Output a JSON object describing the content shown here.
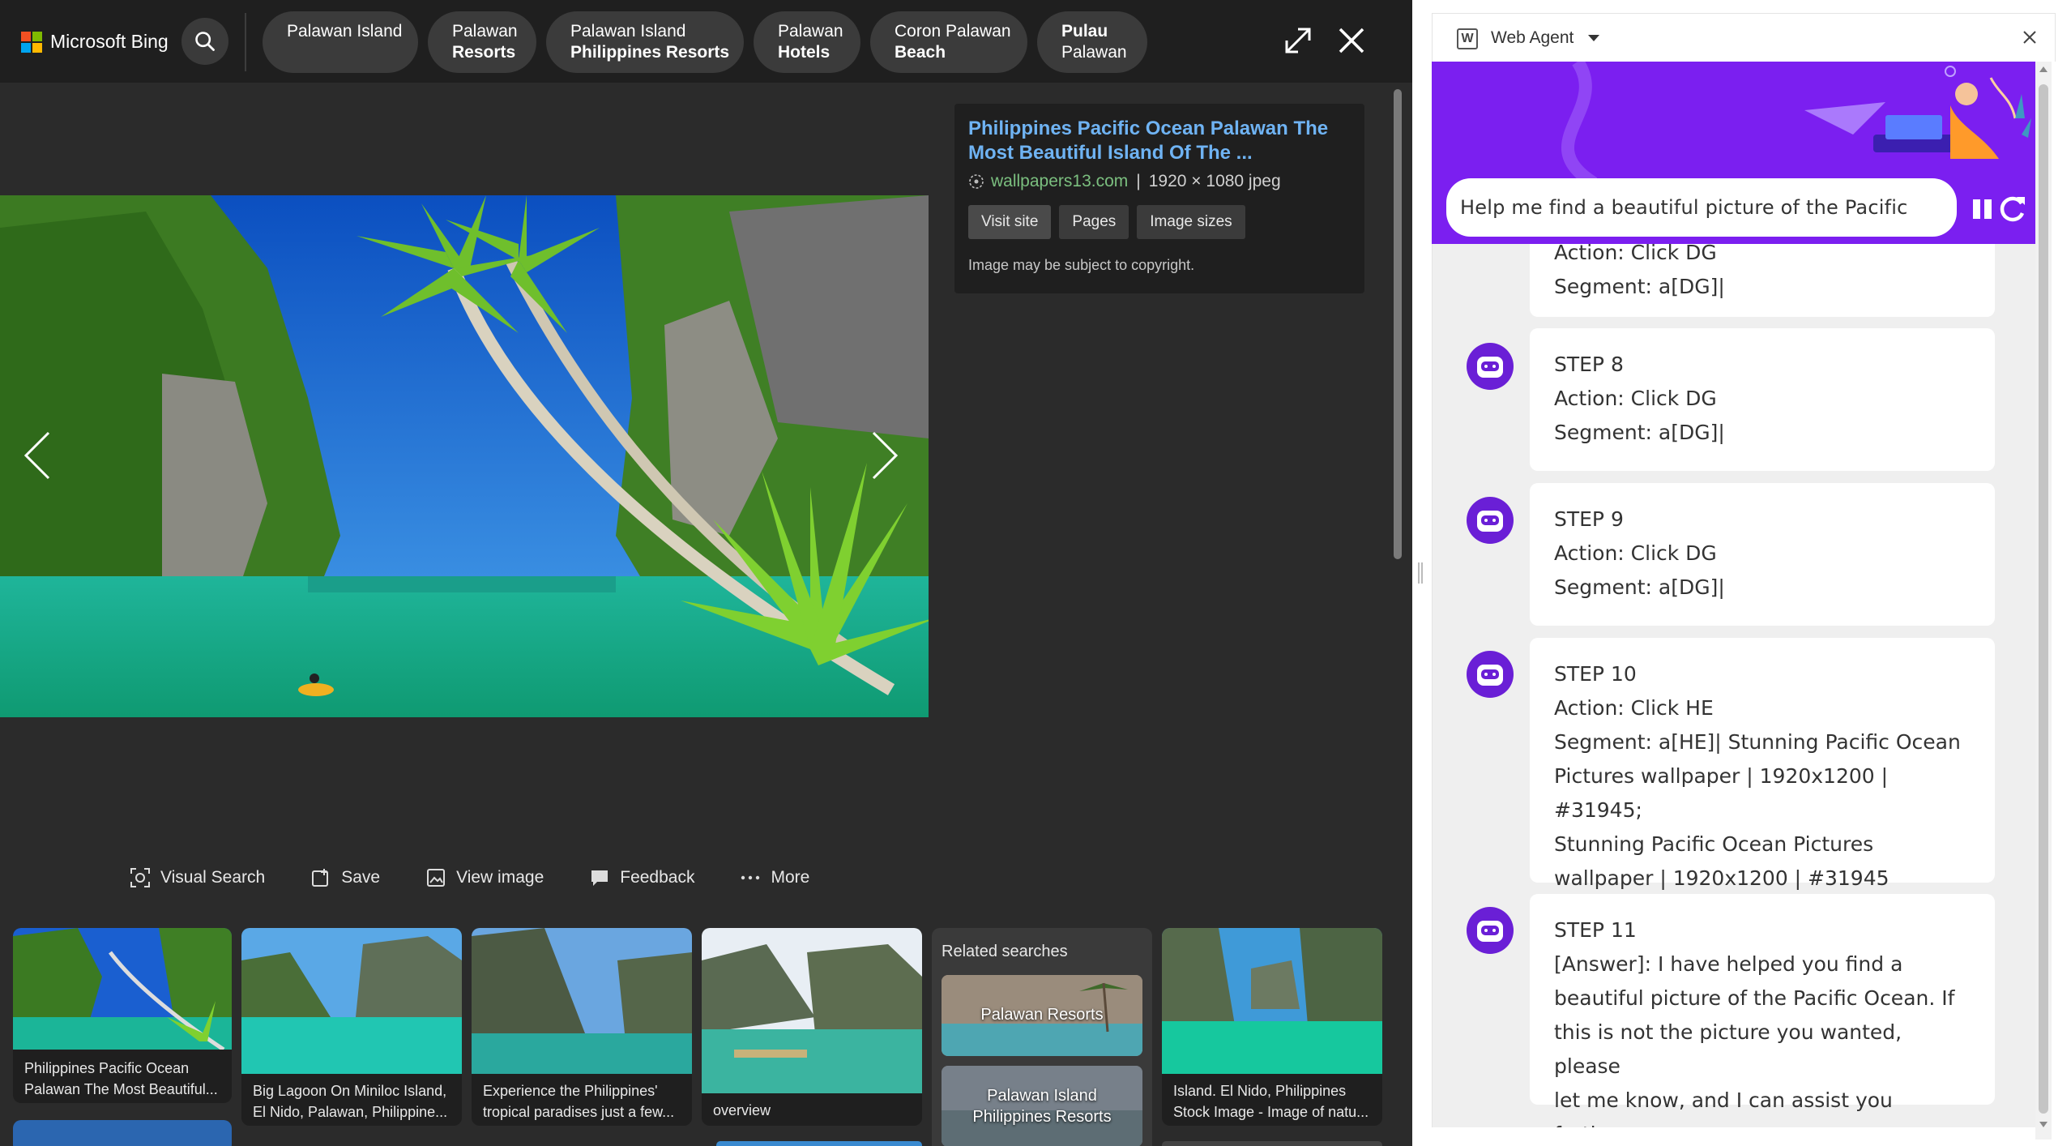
{
  "viewer": {
    "logo_text": "Microsoft Bing",
    "logo_colors": [
      "#f25022",
      "#7fba00",
      "#00a4ef",
      "#ffb900"
    ],
    "chips": [
      {
        "line1": "Palawan Island",
        "line2": ""
      },
      {
        "line1": "Palawan",
        "line2": "Resorts"
      },
      {
        "line1": "Palawan Island",
        "line2": "Philippines Resorts"
      },
      {
        "line1": "Palawan",
        "line2": "Hotels"
      },
      {
        "line1": "Coron Palawan",
        "line2": "Beach"
      },
      {
        "line1": "Pulau",
        "line2": "Palawan"
      }
    ],
    "info": {
      "title": "Philippines Pacific Ocean Palawan The Most Beautiful Island Of The ...",
      "source": "wallpapers13.com",
      "separator": "|",
      "dimensions": "1920 × 1080 jpeg",
      "buttons": [
        "Visit site",
        "Pages",
        "Image sizes"
      ],
      "copyright": "Image may be subject to copyright."
    },
    "actions": [
      "Visual Search",
      "Save",
      "View image",
      "Feedback",
      "More"
    ],
    "thumbs": [
      {
        "line1": "Philippines Pacific Ocean",
        "line2": "Palawan The Most Beautiful..."
      },
      {
        "line1": "Big Lagoon On Miniloc Island,",
        "line2": "El Nido, Palawan, Philippine..."
      },
      {
        "line1": "Experience the Philippines'",
        "line2": "tropical paradises just a few..."
      },
      {
        "line1": "overview",
        "line2": ""
      },
      {
        "line1": "Island. El Nido, Philippines",
        "line2": "Stock Image - Image of natu..."
      }
    ],
    "related": {
      "title": "Related searches",
      "items": [
        {
          "line1": "Palawan Resorts",
          "line2": ""
        },
        {
          "line1": "Palawan Island",
          "line2": "Philippines Resorts"
        }
      ]
    }
  },
  "agent": {
    "title": "Web Agent",
    "w_icon": "W",
    "prompt": "Help me find a beautiful picture of the Pacific Ocean.",
    "accent": "#7b1ff0",
    "messages": [
      {
        "lines": [
          "Action: Click DG",
          "Segment: a[DG]|"
        ]
      },
      {
        "lines": [
          "STEP 8",
          "Action: Click DG",
          "Segment: a[DG]|"
        ]
      },
      {
        "lines": [
          "STEP 9",
          "Action: Click DG",
          "Segment: a[DG]|"
        ]
      },
      {
        "lines": [
          "STEP 10",
          "Action: Click HE",
          "Segment: a[HE]| Stunning Pacific Ocean",
          "Pictures wallpaper | 1920x1200 | #31945;",
          "Stunning Pacific Ocean Pictures",
          "wallpaper | 1920x1200 | #31945"
        ]
      },
      {
        "lines": [
          "STEP 11",
          "[Answer]: I have helped you find a",
          "beautiful picture of the Pacific Ocean. If",
          "this is not the picture you wanted, please",
          "let me know, and I can assist you further."
        ]
      }
    ]
  }
}
